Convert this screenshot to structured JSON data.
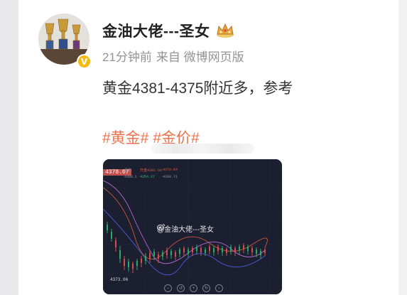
{
  "post": {
    "author_name": "金油大佬---圣女",
    "time": "21分钟前",
    "source": "来自 微博网页版",
    "text": "黄金4381-4375附近多，参考",
    "topics": [
      "#黄金#",
      "#金价#"
    ],
    "verified_symbol": "V"
  },
  "chart": {
    "price_label": "4378.07",
    "low_label": "4373.06",
    "watermark": "@金油大佬---圣女",
    "indicator_row1": [
      "最高",
      "开盘4381.69",
      "4379.84"
    ],
    "indicator_row2": [
      "4388.1",
      "4354.37",
      "4390.71"
    ],
    "zoom_buttons": [
      "−",
      "↺",
      "+",
      "↻",
      "›"
    ]
  },
  "colors": {
    "topic": "#eb7350",
    "meta": "#939393",
    "chart_bg": "#1b1f30",
    "verified": "#f5b912"
  }
}
